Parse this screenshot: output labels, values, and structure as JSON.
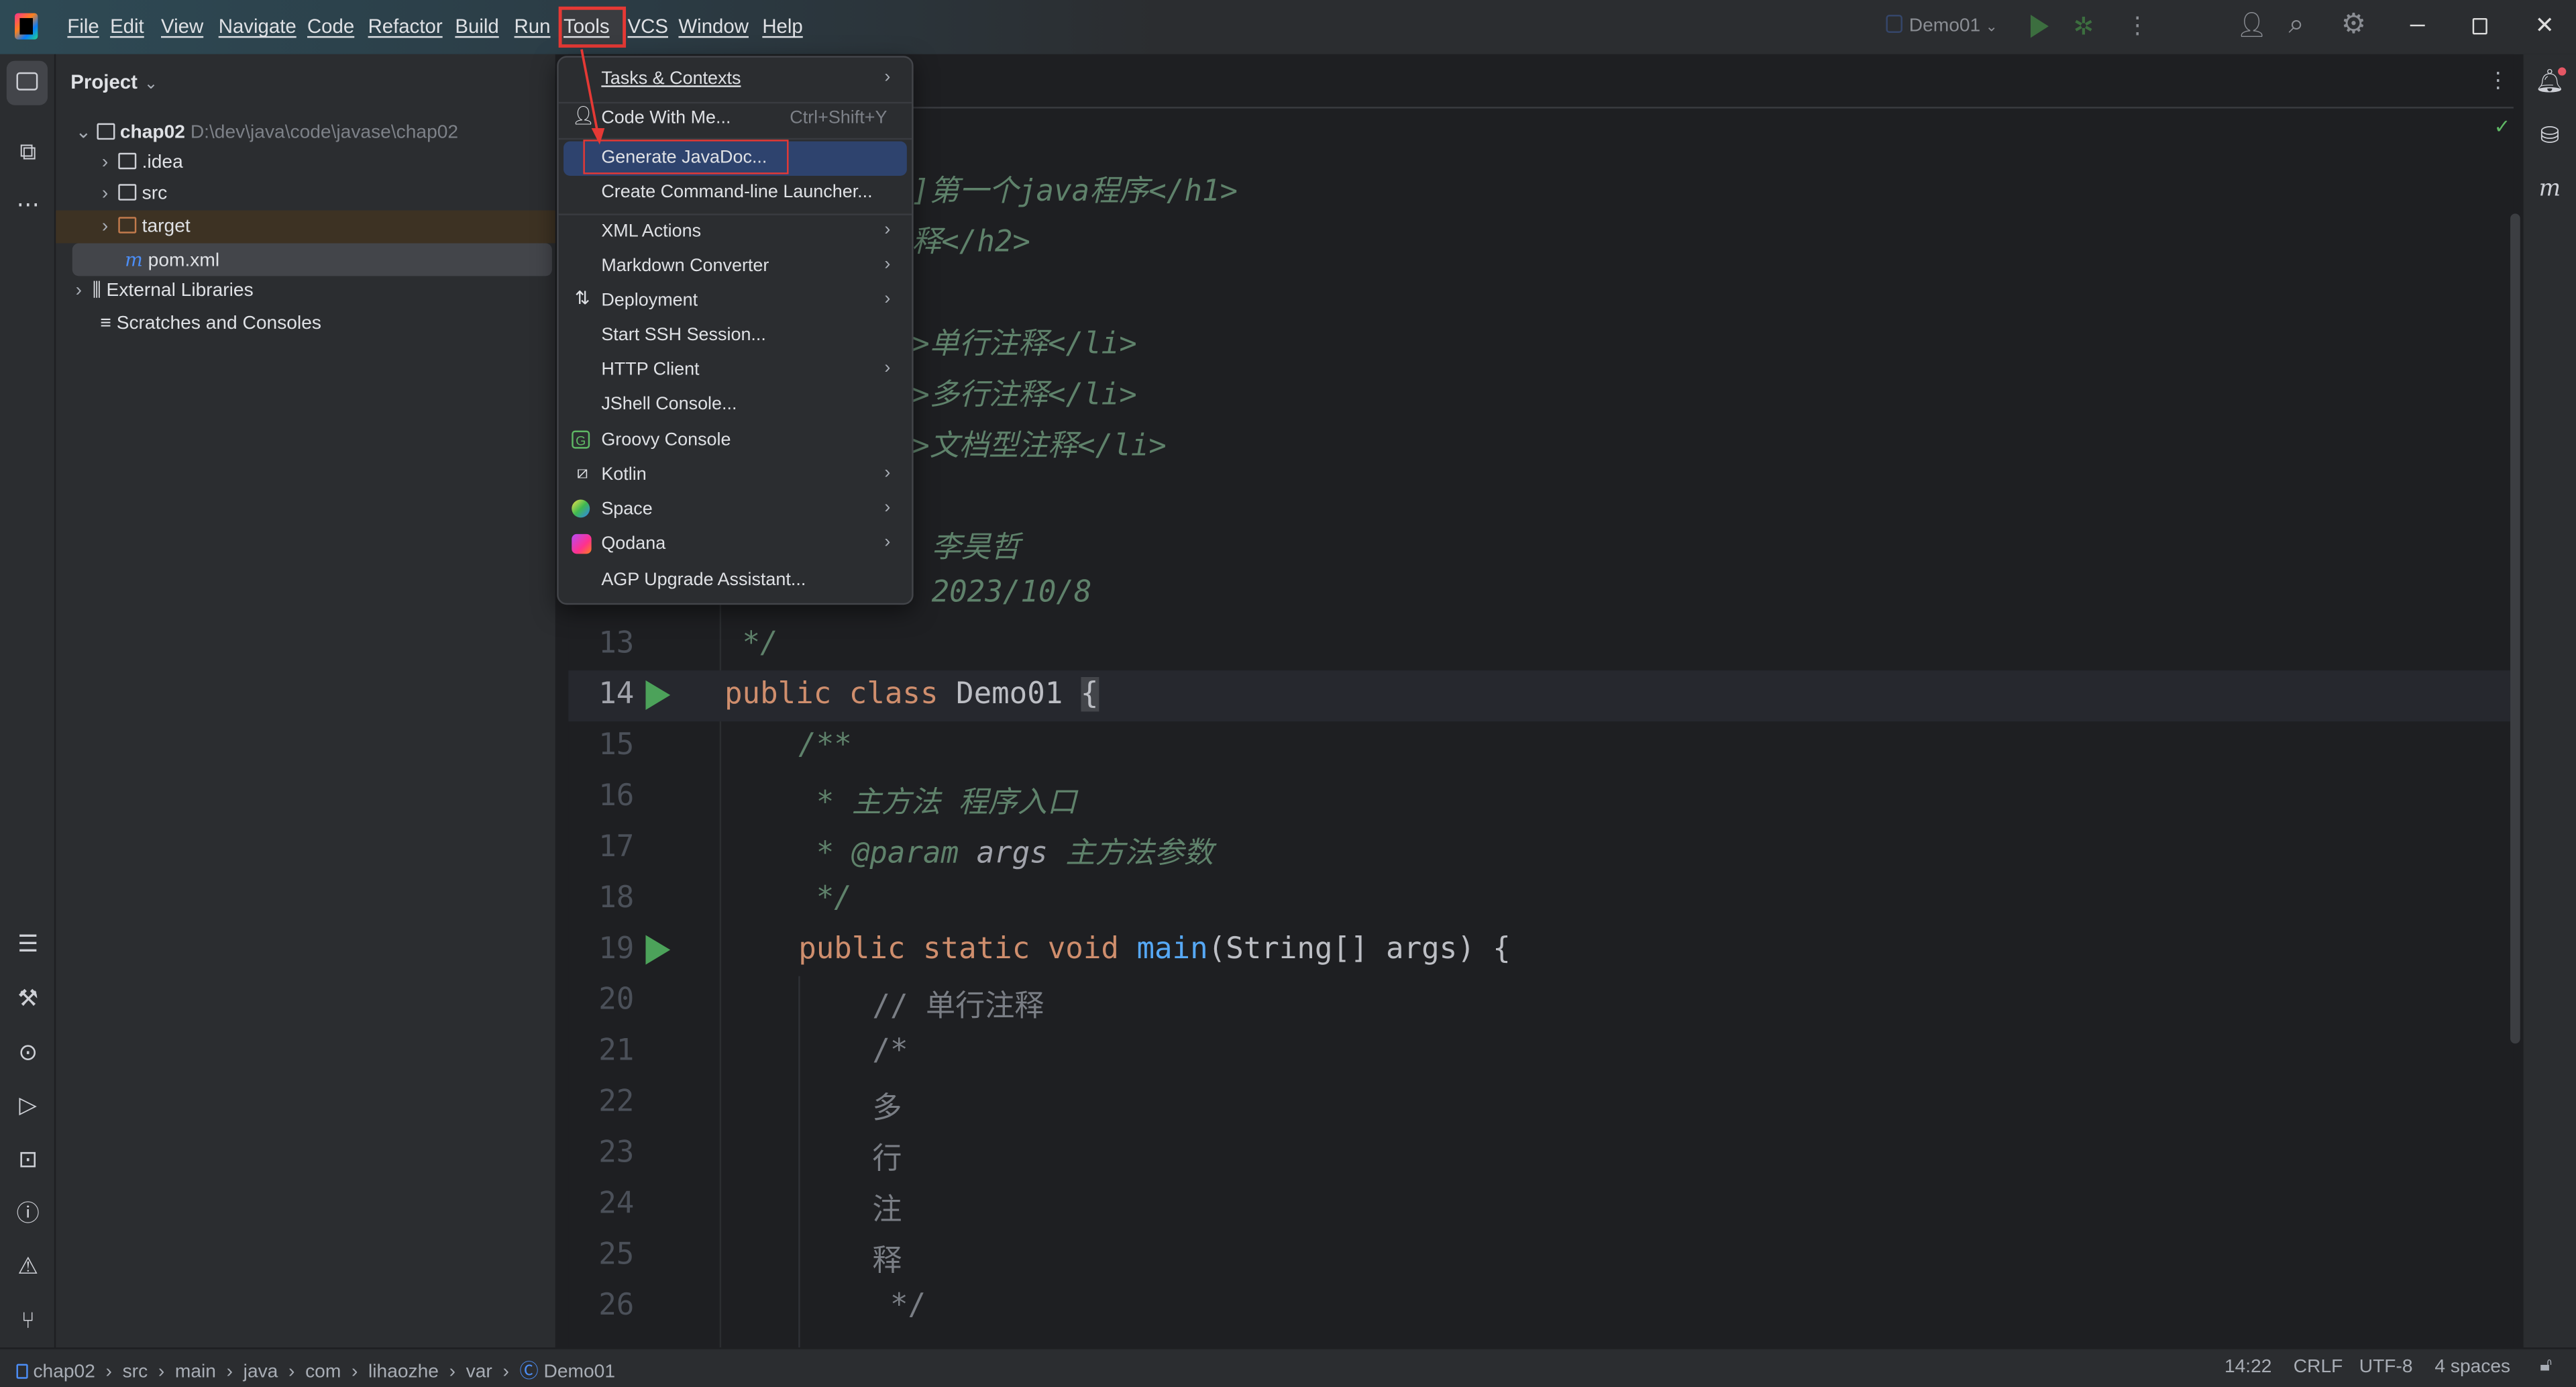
{
  "titlebar": {
    "menus": [
      "File",
      "Edit",
      "View",
      "Navigate",
      "Code",
      "Refactor",
      "Build",
      "Run",
      "Tools",
      "VCS",
      "Window",
      "Help"
    ],
    "active_menu": "Tools",
    "run_config": "Demo01"
  },
  "project": {
    "header": "Project",
    "root": {
      "name": "chap02",
      "path": "D:\\dev\\java\\code\\javase\\chap02"
    },
    "children": [
      ".idea",
      "src",
      "target",
      "pom.xml"
    ],
    "external": "External Libraries",
    "scratches": "Scratches and Consoles"
  },
  "tools_menu": {
    "items": [
      {
        "label": "Tasks & Contexts",
        "submenu": true
      },
      {
        "label": "Code With Me...",
        "shortcut": "Ctrl+Shift+Y",
        "icon": "user-plus-icon"
      },
      {
        "label": "Generate JavaDoc...",
        "highlighted": true
      },
      {
        "label": "Create Command-line Launcher..."
      },
      {
        "label": "XML Actions",
        "submenu": true
      },
      {
        "label": "Markdown Converter",
        "submenu": true
      },
      {
        "label": "Deployment",
        "submenu": true,
        "icon": "deployment-icon"
      },
      {
        "label": "Start SSH Session..."
      },
      {
        "label": "HTTP Client",
        "submenu": true
      },
      {
        "label": "JShell Console..."
      },
      {
        "label": "Groovy Console",
        "icon": "groovy-icon"
      },
      {
        "label": "Kotlin",
        "submenu": true,
        "icon": "kotlin-icon"
      },
      {
        "label": "Space",
        "submenu": true,
        "icon": "space-icon"
      },
      {
        "label": "Qodana",
        "submenu": true,
        "icon": "qodana-icon"
      },
      {
        "label": "AGP Upgrade Assistant..."
      }
    ]
  },
  "editor": {
    "hidden_fragments": {
      "l4": "]第一个java程序</h1>",
      "l5": "释</h2>",
      "l8": ">单行注释</li>",
      "l9": ">多行注释</li>",
      "l10": ">文档型注释</li>",
      "l11": "李昊哲",
      "l12": "2023/10/8"
    },
    "line_numbers": [
      "13",
      "14",
      "15",
      "16",
      "17",
      "18",
      "19",
      "20",
      "21",
      "22",
      "23",
      "24",
      "25",
      "26"
    ],
    "lines": {
      "l13": " */",
      "l14_kw": "public class",
      "l14_name": " Demo01 ",
      "l14_brace": "{",
      "l15": "/**",
      "l16_star": " * ",
      "l16_text": "主方法 程序入口",
      "l17_star": " * ",
      "l17_tag": "@param",
      "l17_arg": " args ",
      "l17_text": "主方法参数",
      "l18": " */",
      "l19_kw": "public static void ",
      "l19_fn": "main",
      "l19_rest": "(String[] args) {",
      "l20": "// 单行注释",
      "l21": "/*",
      "l22": "多",
      "l23": "行",
      "l24": "注",
      "l25": "释",
      "l26": " */"
    }
  },
  "statusbar": {
    "breadcrumb": [
      "chap02",
      "src",
      "main",
      "java",
      "com",
      "lihaozhe",
      "var",
      "Demo01"
    ],
    "position": "14:22",
    "line_ending": "CRLF",
    "encoding": "UTF-8",
    "indent": "4 spaces"
  },
  "colors": {
    "accent": "#2e436e",
    "highlight_box": "#e53935",
    "keyword": "#cf8e6d",
    "doc_comment": "#5f826b",
    "function": "#56a8f5"
  }
}
